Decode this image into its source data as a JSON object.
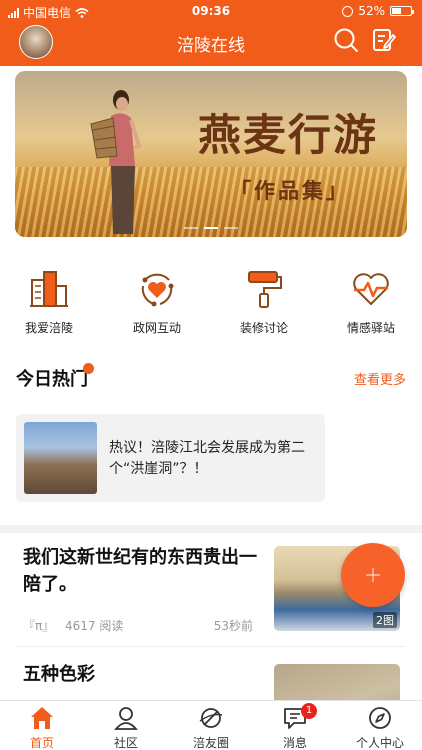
{
  "status_bar": {
    "carrier": "中国电信",
    "time": "09:36",
    "battery": "52%",
    "battery_level": 0.52
  },
  "header": {
    "title": "涪陵在线"
  },
  "banner": {
    "title": "燕麦行游",
    "subtitle": "「作品集」",
    "slide_count": 3,
    "active_slide": 2
  },
  "quick_nav": [
    {
      "label": "我爱涪陵",
      "icon": "city-buildings-icon"
    },
    {
      "label": "政网互动",
      "icon": "heart-cycle-icon"
    },
    {
      "label": "装修讨论",
      "icon": "paint-roller-icon"
    },
    {
      "label": "情感驿站",
      "icon": "heartbeat-icon"
    }
  ],
  "today_hot": {
    "title": "今日热门",
    "more": "查看更多",
    "card_text": "热议！涪陵江北会发展成为第二个“洪崖洞”？！"
  },
  "feed": [
    {
      "title": "我们这新世纪有的东西贵出一陪了。",
      "source": "『π』",
      "reads": "4617 阅读",
      "time": "53秒前",
      "image_count": "2图"
    },
    {
      "title": "五种色彩"
    }
  ],
  "tabbar": [
    {
      "label": "首页",
      "icon": "home-icon",
      "active": true
    },
    {
      "label": "社区",
      "icon": "community-icon"
    },
    {
      "label": "涪友圈",
      "icon": "planet-icon"
    },
    {
      "label": "消息",
      "icon": "message-icon",
      "badge": "1"
    },
    {
      "label": "个人中心",
      "icon": "compass-icon"
    }
  ],
  "colors": {
    "brand": "#f25c1b",
    "icon_brown": "#8a4a1c",
    "badge_red": "#e8231c"
  }
}
